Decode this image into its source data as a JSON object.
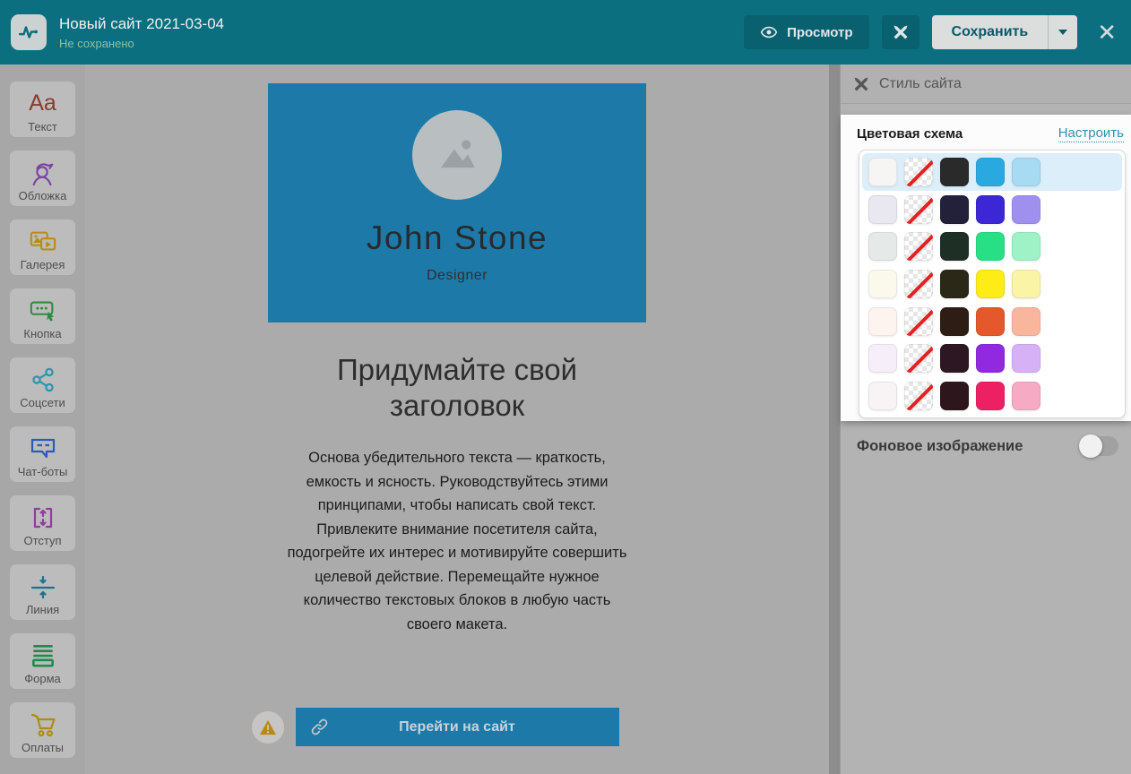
{
  "header": {
    "title": "Новый сайт 2021-03-04",
    "status": "Не сохранено",
    "preview_label": "Просмотр",
    "save_label": "Сохранить",
    "bar_color": "#0c6f80",
    "button_color": "#09606f"
  },
  "sidebar": {
    "items": [
      {
        "id": "text",
        "label": "Текст",
        "icon": "text-icon",
        "color": "#8a3a2e"
      },
      {
        "id": "cover",
        "label": "Обложка",
        "icon": "person-icon",
        "color": "#7b41a1"
      },
      {
        "id": "gallery",
        "label": "Галерея",
        "icon": "gallery-icon",
        "color": "#bd8a12"
      },
      {
        "id": "button",
        "label": "Кнопка",
        "icon": "button-icon",
        "color": "#2f8a41"
      },
      {
        "id": "social",
        "label": "Соцсети",
        "icon": "share-icon",
        "color": "#2f93ab"
      },
      {
        "id": "chatbots",
        "label": "Чат-боты",
        "icon": "chat-icon",
        "color": "#2b59bd"
      },
      {
        "id": "spacing",
        "label": "Отступ",
        "icon": "spacing-icon",
        "color": "#8f3f9b"
      },
      {
        "id": "line",
        "label": "Линия",
        "icon": "line-icon",
        "color": "#20708c"
      },
      {
        "id": "form",
        "label": "Форма",
        "icon": "form-icon",
        "color": "#1f8a4d"
      },
      {
        "id": "payments",
        "label": "Оплаты",
        "icon": "cart-icon",
        "color": "#ad8d10"
      }
    ]
  },
  "canvas": {
    "cover": {
      "name": "John Stone",
      "role": "Designer",
      "background": "#1d7aa8"
    },
    "heading": "Придумайте свой заголовок",
    "body": "Основа убедительного текста — краткость, емкость и ясность. Руководствуйтесь этими принципами, чтобы написать свой текст. Привлеките внимание посетителя сайта, подогрейте их интерес и мотивируйте совершить целевой действие. Перемещайте нужное количество текстовых блоков в любую часть своего макета.",
    "button_label": "Перейти на сайт"
  },
  "panel": {
    "title": "Стиль сайта",
    "section_title": "Цветовая схема",
    "customize_link": "Настроить",
    "selected_scheme_index": 0,
    "selected_row_color": "#dbeefa",
    "schemes": [
      {
        "selected": true,
        "swatches": [
          "#f6f5f3",
          "none",
          "#2a2a2a",
          "#2aa9e0",
          "#a7daf3"
        ]
      },
      {
        "selected": false,
        "swatches": [
          "#e9e7ef",
          "none",
          "#232039",
          "#3c27d6",
          "#9f90ee"
        ]
      },
      {
        "selected": false,
        "swatches": [
          "#e5e9e7",
          "none",
          "#1e2f26",
          "#27e085",
          "#9ff2c6"
        ]
      },
      {
        "selected": false,
        "swatches": [
          "#fbf9ec",
          "none",
          "#2c2818",
          "#fdec16",
          "#faf4a6"
        ]
      },
      {
        "selected": false,
        "swatches": [
          "#fdf4f0",
          "none",
          "#2d1d15",
          "#e4582b",
          "#fab69d"
        ]
      },
      {
        "selected": false,
        "swatches": [
          "#f6eef9",
          "none",
          "#2d1722",
          "#9129e0",
          "#d7b1f6"
        ]
      },
      {
        "selected": false,
        "swatches": [
          "#f8f4f5",
          "none",
          "#2e171c",
          "#ee2064",
          "#f6aac3"
        ]
      }
    ],
    "background_image_label": "Фоновое изображение",
    "background_image_toggle": "off"
  }
}
